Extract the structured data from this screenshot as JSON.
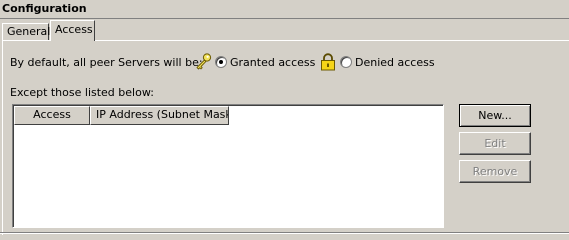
{
  "panel": {
    "title": "Configuration"
  },
  "tabs": [
    {
      "label": "General",
      "active": false
    },
    {
      "label": "Access",
      "active": true
    }
  ],
  "access": {
    "default_label": "By default, all peer Servers will be:",
    "granted_label": "Granted access",
    "granted_checked": true,
    "granted_icon": "key-icon",
    "denied_label": "Denied access",
    "denied_checked": false,
    "denied_icon": "lock-icon",
    "except_label": "Except those listed below:"
  },
  "list": {
    "columns": [
      "Access",
      "IP Address (Subnet Mask)"
    ],
    "rows": []
  },
  "buttons": {
    "new_label": "New...",
    "edit_label": "Edit",
    "edit_enabled": false,
    "remove_label": "Remove",
    "remove_enabled": false
  }
}
